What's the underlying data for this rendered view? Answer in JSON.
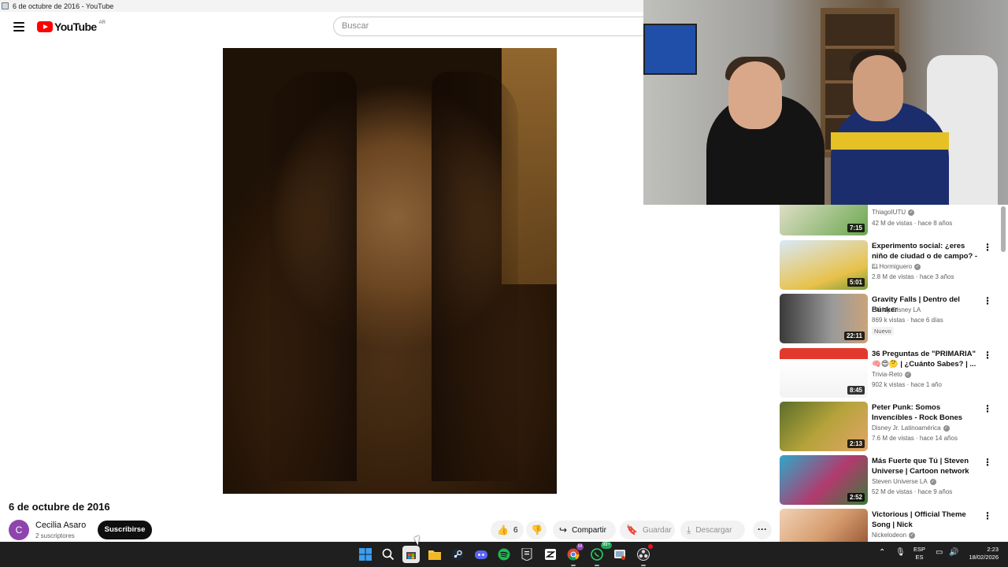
{
  "window": {
    "title": "6 de octubre de 2016 - YouTube"
  },
  "header": {
    "logo_text": "YouTube",
    "country_code": "AR",
    "search_placeholder": "Buscar"
  },
  "video": {
    "title": "6 de octubre de 2016",
    "channel": {
      "avatar_letter": "C",
      "name": "Cecilia Asaro",
      "subscribers": "2 suscriptores"
    },
    "subscribe_label": "Suscribirse",
    "likes": "6",
    "share_label": "Compartir",
    "save_label": "Guardar",
    "download_label": "Descargar"
  },
  "recommendations": [
    {
      "title": "",
      "channel": "ThiagoIUTU",
      "verified": true,
      "meta": "42 M de vistas · hace 8 años",
      "duration": "7:15",
      "thumb_color": "#6aa84f"
    },
    {
      "title": "Experimento social: ¿eres niño de ciudad o de campo? - ...",
      "channel": "El Hormiguero",
      "verified": true,
      "meta": "2.8 M de vistas · hace 3 años",
      "duration": "5:01",
      "thumb_color": "#e8c14a"
    },
    {
      "title": "Gravity Falls | Dentro del Búnker",
      "channel": "Oh My Disney LA",
      "verified": false,
      "meta": "869 k vistas · hace 6 días",
      "badge": "Nuevo",
      "duration": "22:11",
      "thumb_color": "#7a7a7a"
    },
    {
      "title": "36 Preguntas de \"PRIMARIA\" 🧠😍🤔 | ¿Cuánto Sabes? | ...",
      "channel": "Trivia-Reto",
      "verified": true,
      "meta": "902 k vistas · hace 1 año",
      "duration": "8:45",
      "thumb_color": "#c0392b"
    },
    {
      "title": "Peter Punk: Somos Invencibles - Rock Bones",
      "channel": "Disney Jr. Latinoamérica",
      "verified": true,
      "meta": "7.6 M de vistas · hace 14 años",
      "duration": "2:13",
      "thumb_color": "#b5a33a"
    },
    {
      "title": "Más Fuerte que Tú | Steven Universe | Cartoon network",
      "channel": "Steven Universe LA",
      "verified": true,
      "meta": "52 M de vistas · hace 9 años",
      "duration": "2:52",
      "thumb_color": "#2ea8c9"
    },
    {
      "title": "Victorious | Official Theme Song | Nick",
      "channel": "Nickelodeon",
      "verified": true,
      "meta": "",
      "duration": "",
      "thumb_color": "#d69c6e"
    }
  ],
  "taskbar": {
    "lang": "ESP",
    "region": "ES",
    "time": "2:23",
    "date": "18/02/2026",
    "whatsapp_badge": "99+"
  }
}
